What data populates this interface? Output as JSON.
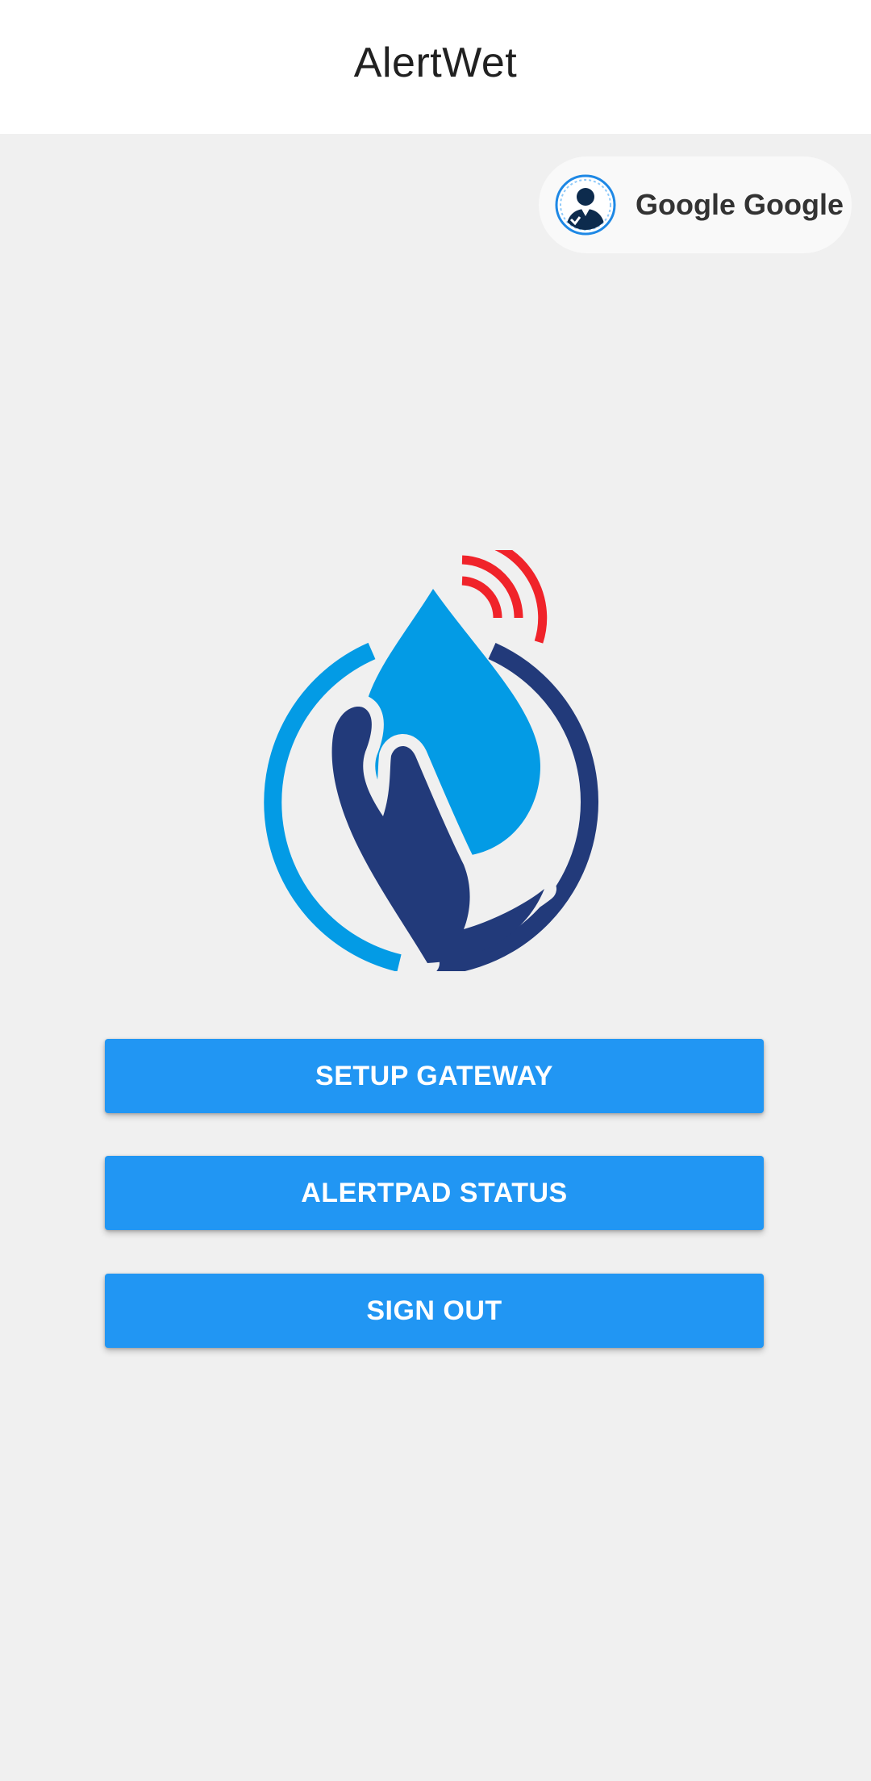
{
  "app": {
    "title": "AlertWet"
  },
  "account": {
    "name": "Google Google",
    "avatar_icon": "user-avatar-icon"
  },
  "logo": {
    "icon": "water-drop-hand-wifi-logo",
    "colors": {
      "drop": "#039be5",
      "hand": "#223a7a",
      "ring_left": "#039be5",
      "ring_right": "#223a7a",
      "signal": "#f0232a"
    }
  },
  "buttons": {
    "setup_gateway": "SETUP GATEWAY",
    "alertpad_status": "ALERTPAD STATUS",
    "sign_out": "SIGN OUT"
  },
  "theme": {
    "accent": "#2196f3",
    "background": "#f0f0f0",
    "toolbar": "#ffffff"
  }
}
